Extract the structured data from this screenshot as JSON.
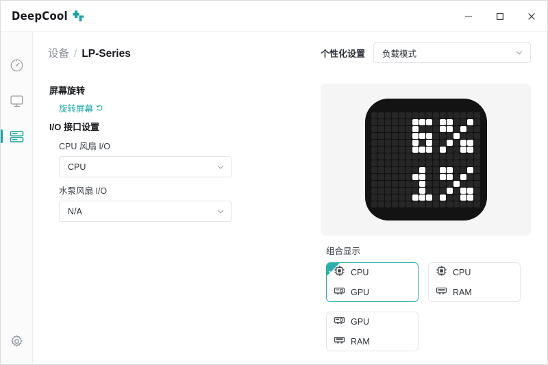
{
  "window": {
    "brand": "DeepCool",
    "controls": [
      {
        "name": "minimize",
        "label": "–"
      },
      {
        "name": "maximize",
        "label": "☐"
      },
      {
        "name": "close",
        "label": "✕"
      }
    ]
  },
  "sidebar": {
    "items": [
      {
        "icon": "dashboard-gauge-icon",
        "active": false
      },
      {
        "icon": "monitor-icon",
        "active": false
      },
      {
        "icon": "device-list-icon",
        "active": true
      }
    ],
    "bottom": {
      "icon": "gear-icon",
      "active": false
    }
  },
  "header": {
    "breadcrumb_root": "设备",
    "breadcrumb_sep": "/",
    "breadcrumb_current": "LP-Series",
    "personalize_label": "个性化设置",
    "mode_select_value": "负载模式"
  },
  "left_pane": {
    "rotation_section_title": "屏幕旋转",
    "rotate_link_label": "旋转屏幕",
    "io_section_title": "I/O 接口设置",
    "cpu_fan_label": "CPU 风扇 I/O",
    "cpu_fan_value": "CPU",
    "pump_fan_label": "水泵风扇 I/O",
    "pump_fan_value": "N/A"
  },
  "right_pane": {
    "combo_title": "组合显示",
    "cards": [
      {
        "selected": true,
        "rows": [
          {
            "icon": "cpu-chip-icon",
            "label": "CPU"
          },
          {
            "icon": "gpu-card-icon",
            "label": "GPU"
          }
        ]
      },
      {
        "selected": false,
        "rows": [
          {
            "icon": "cpu-chip-icon",
            "label": "CPU"
          },
          {
            "icon": "ram-stick-icon",
            "label": "RAM"
          }
        ]
      },
      {
        "selected": false,
        "rows": [
          {
            "icon": "gpu-card-icon",
            "label": "GPU"
          },
          {
            "icon": "ram-stick-icon",
            "label": "RAM"
          }
        ]
      }
    ]
  },
  "led_preview": {
    "top_value": "5%",
    "bottom_value": "1%",
    "columns": 16,
    "rows": 14,
    "on_color": "#ffffff",
    "off_color": "#262626",
    "panel_color": "#131313",
    "lit_cells": [
      [
        1,
        6
      ],
      [
        1,
        7
      ],
      [
        1,
        8
      ],
      [
        1,
        10
      ],
      [
        1,
        11
      ],
      [
        1,
        14
      ],
      [
        2,
        6
      ],
      [
        2,
        10
      ],
      [
        2,
        11
      ],
      [
        2,
        13
      ],
      [
        3,
        6
      ],
      [
        3,
        7
      ],
      [
        3,
        8
      ],
      [
        3,
        12
      ],
      [
        4,
        6
      ],
      [
        4,
        8
      ],
      [
        4,
        11
      ],
      [
        4,
        13
      ],
      [
        4,
        14
      ],
      [
        5,
        6
      ],
      [
        5,
        7
      ],
      [
        5,
        8
      ],
      [
        5,
        10
      ],
      [
        5,
        13
      ],
      [
        5,
        14
      ],
      [
        8,
        7
      ],
      [
        8,
        10
      ],
      [
        8,
        11
      ],
      [
        8,
        14
      ],
      [
        9,
        6
      ],
      [
        9,
        7
      ],
      [
        9,
        10
      ],
      [
        9,
        11
      ],
      [
        9,
        13
      ],
      [
        10,
        7
      ],
      [
        10,
        12
      ],
      [
        11,
        7
      ],
      [
        11,
        11
      ],
      [
        11,
        13
      ],
      [
        11,
        14
      ],
      [
        12,
        6
      ],
      [
        12,
        7
      ],
      [
        12,
        8
      ],
      [
        12,
        10
      ],
      [
        12,
        13
      ],
      [
        12,
        14
      ]
    ]
  },
  "colors": {
    "accent": "#16a5a5",
    "accent_card": "#2bb0ad",
    "text_primary": "#16181c",
    "text_muted": "#8a8f99",
    "panel_bg": "#f5f5f5",
    "border": "#e2e4e8"
  }
}
